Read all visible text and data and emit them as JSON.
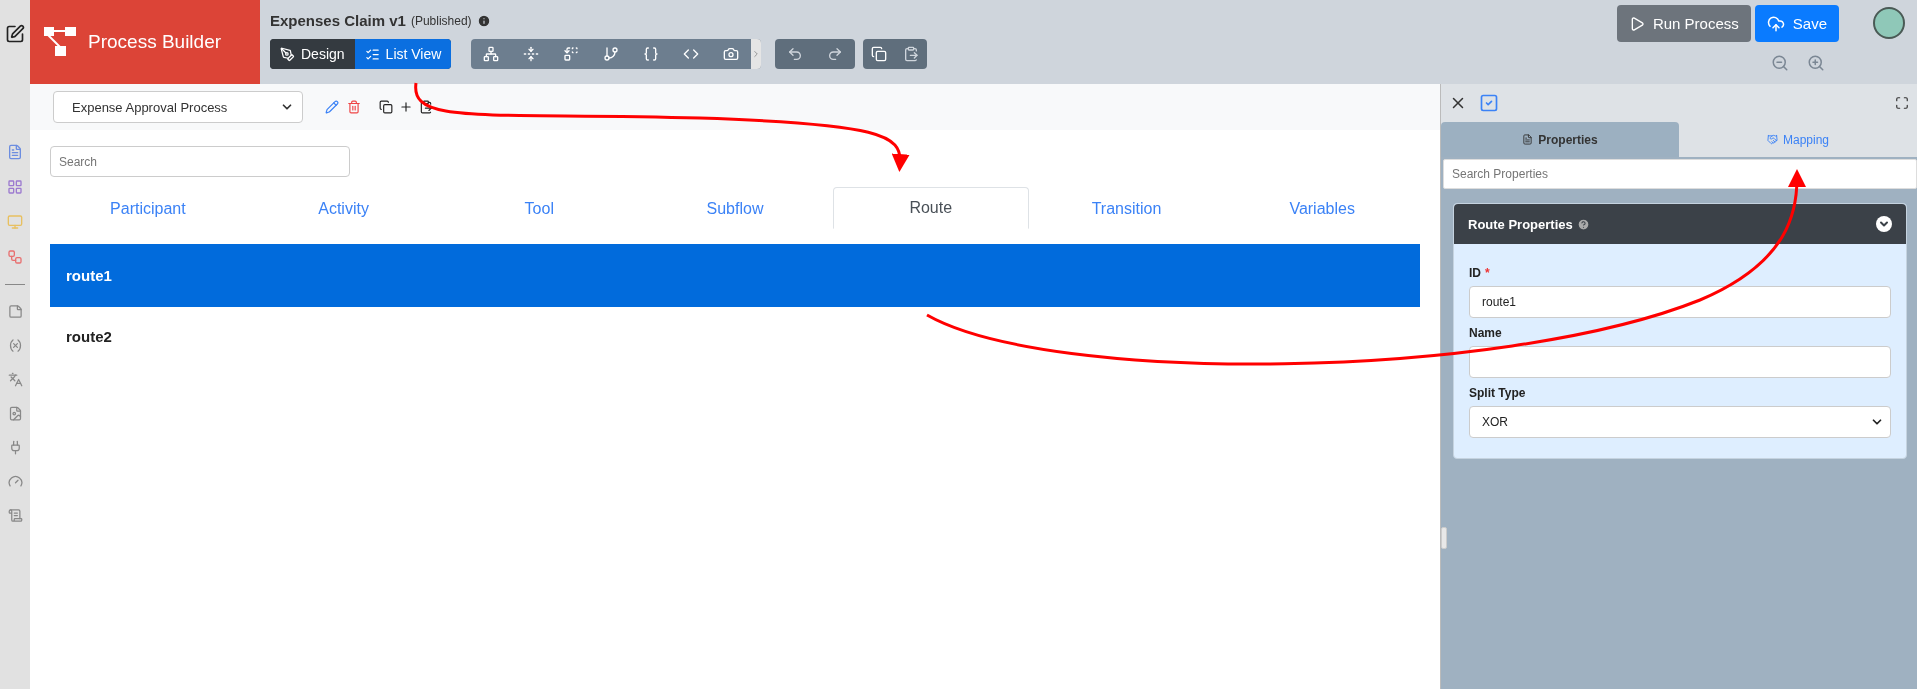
{
  "app": {
    "name": "Process Builder"
  },
  "process": {
    "title": "Expenses Claim v1",
    "status": "(Published)"
  },
  "view_toggle": [
    {
      "label": "Design",
      "selected": false
    },
    {
      "label": "List View",
      "selected": true
    }
  ],
  "actions": [
    {
      "label": "Run Process",
      "kind": "secondary"
    },
    {
      "label": "Save",
      "kind": "primary"
    }
  ],
  "process_select": {
    "value": "Expense Approval Process"
  },
  "search": {
    "placeholder": "Search"
  },
  "tabs": [
    {
      "label": "Participant",
      "selected": false
    },
    {
      "label": "Activity",
      "selected": false
    },
    {
      "label": "Tool",
      "selected": false
    },
    {
      "label": "Subflow",
      "selected": false
    },
    {
      "label": "Route",
      "selected": true
    },
    {
      "label": "Transition",
      "selected": false
    },
    {
      "label": "Variables",
      "selected": false
    }
  ],
  "rows": [
    {
      "label": "route1",
      "selected": true
    },
    {
      "label": "route2",
      "selected": false
    }
  ],
  "panel": {
    "tabs": [
      {
        "label": "Properties",
        "selected": true
      },
      {
        "label": "Mapping",
        "selected": false
      }
    ],
    "search": {
      "placeholder": "Search Properties"
    },
    "required_marker": "*",
    "section": {
      "title": "Route Properties",
      "expanded": true
    },
    "fields": [
      {
        "label": "ID",
        "required": true,
        "kind": "text",
        "value": "route1"
      },
      {
        "label": "Name",
        "required": false,
        "kind": "text"
      },
      {
        "label": "Split Type",
        "required": false,
        "kind": "select",
        "value": "XOR"
      }
    ]
  }
}
